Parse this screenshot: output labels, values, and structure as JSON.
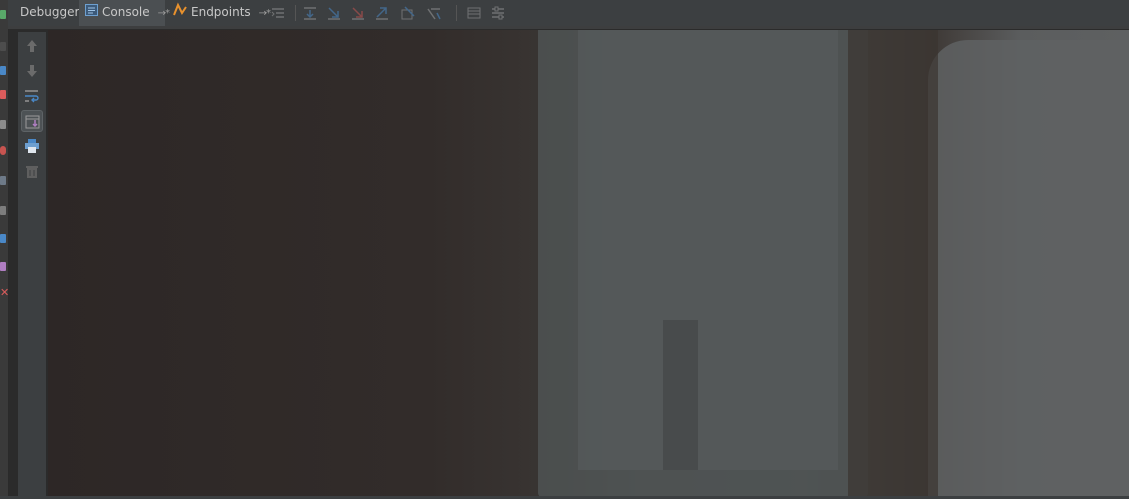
{
  "tabs": [
    {
      "label": "Debugger",
      "active": false
    },
    {
      "label": "Console",
      "active": true,
      "icon": "console-icon",
      "pinned": true
    },
    {
      "label": "Endpoints",
      "active": false,
      "icon": "endpoints-icon",
      "pinned": true
    }
  ],
  "pin_glyph": "→*",
  "toolbar_icons": [
    "show-execution-point-icon",
    "step-over-icon",
    "step-into-icon",
    "force-step-into-icon",
    "step-out-icon",
    "run-to-cursor-icon",
    "evaluate-expression-icon",
    "frames-icon",
    "settings-icon"
  ],
  "side_toolbar": [
    "up-arrow-icon",
    "down-arrow-icon",
    "soft-wrap-icon",
    "scroll-to-end-icon",
    "print-icon",
    "trash-icon"
  ],
  "colors": {
    "accent_orange": "#e8912d",
    "accent_blue": "#4a88c7",
    "accent_red": "#db5c5c"
  }
}
